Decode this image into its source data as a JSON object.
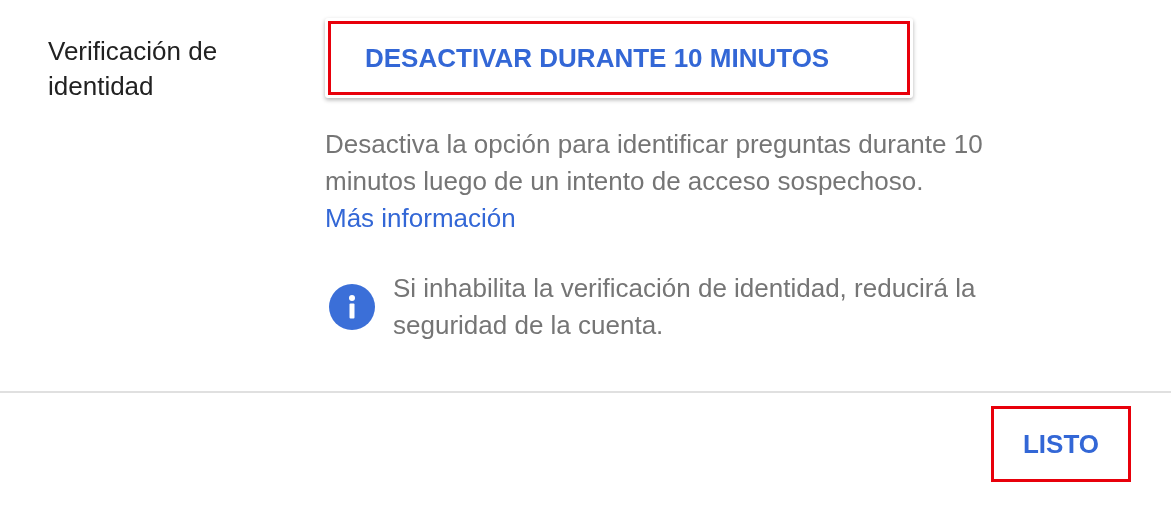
{
  "setting": {
    "label": "Verificación de identidad",
    "button": {
      "label": "DESACTIVAR DURANTE 10 MINUTOS",
      "highlighted": true
    },
    "description": "Desactiva la opción para identificar preguntas durante 10 minutos luego de un intento de acceso sospechoso.",
    "link": "Más información",
    "notice": "Si inhabilita la verificación de identidad, reducirá la seguridad de la cuenta."
  },
  "footer": {
    "button": {
      "label": "LISTO",
      "highlighted": true
    }
  }
}
